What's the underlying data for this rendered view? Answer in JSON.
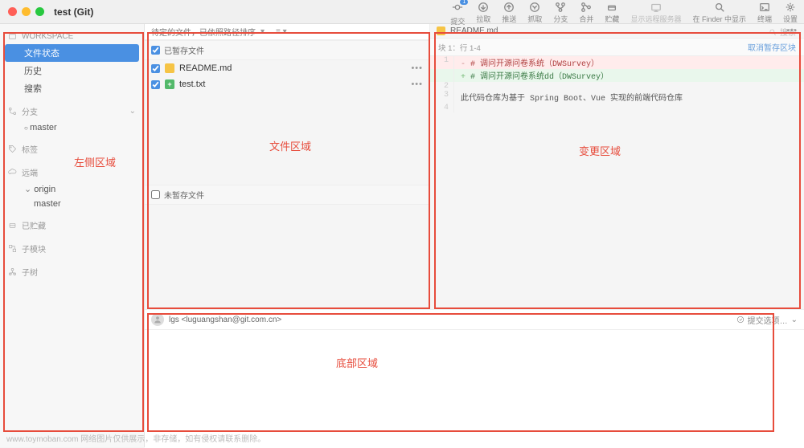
{
  "window": {
    "title": "test (Git)"
  },
  "toolbar": {
    "commit": "提交",
    "commit_badge": "1",
    "pull": "拉取",
    "push": "推送",
    "fetch": "抓取",
    "branch": "分支",
    "merge": "合并",
    "stash": "贮藏",
    "remote_server": "显示远程服务器",
    "finder": "在 Finder 中显示",
    "terminal": "终端",
    "settings": "设置",
    "search_placeholder": "搜索"
  },
  "sidebar": {
    "workspace": {
      "label": "WORKSPACE",
      "items": [
        "文件状态",
        "历史",
        "搜索"
      ],
      "selected": 0
    },
    "branch": {
      "label": "分支",
      "items": [
        "master"
      ]
    },
    "tag": {
      "label": "标签"
    },
    "remote": {
      "label": "远端",
      "items": [
        "origin"
      ],
      "sub": [
        "master"
      ]
    },
    "stashed": {
      "label": "已贮藏"
    },
    "submod": {
      "label": "子模块"
    },
    "subtree": {
      "label": "子树"
    }
  },
  "file_area": {
    "sortbar": {
      "text": "待定的文件，已依照路径排序",
      "arrow": "▾",
      "menu": "≡ ▾"
    },
    "staged_hdr": "已暂存文件",
    "unstaged_hdr": "未暂存文件",
    "files": [
      {
        "name": "README.md",
        "badge": "y"
      },
      {
        "name": "test.txt",
        "badge": "g"
      }
    ]
  },
  "diff": {
    "tab": "README.md",
    "hunk": "块 1：行 1-4",
    "unstage": "取消暂存区块",
    "lines": [
      {
        "n": "1",
        "t": "del",
        "text": "# 调问开源问卷系统（DWSurvey）"
      },
      {
        "n": "",
        "t": "add",
        "text": "# 调问开源问卷系统dd（DWSurvey）"
      },
      {
        "n": "2",
        "t": "ctx",
        "text": ""
      },
      {
        "n": "3",
        "t": "ctx",
        "text": "此代码仓库为基于 Spring Boot、Vue 实现的前端代码仓库"
      },
      {
        "n": "4",
        "t": "ctx",
        "text": ""
      }
    ]
  },
  "commit": {
    "author": "lgs <luguangshan@git.com.cn>",
    "options": "提交选项…"
  },
  "annotations": {
    "left": "左侧区域",
    "files": "文件区域",
    "diff": "变更区域",
    "bottom": "底部区域"
  },
  "watermark": "www.toymoban.com 网络图片仅供展示，非存储，如有侵权请联系删除。"
}
